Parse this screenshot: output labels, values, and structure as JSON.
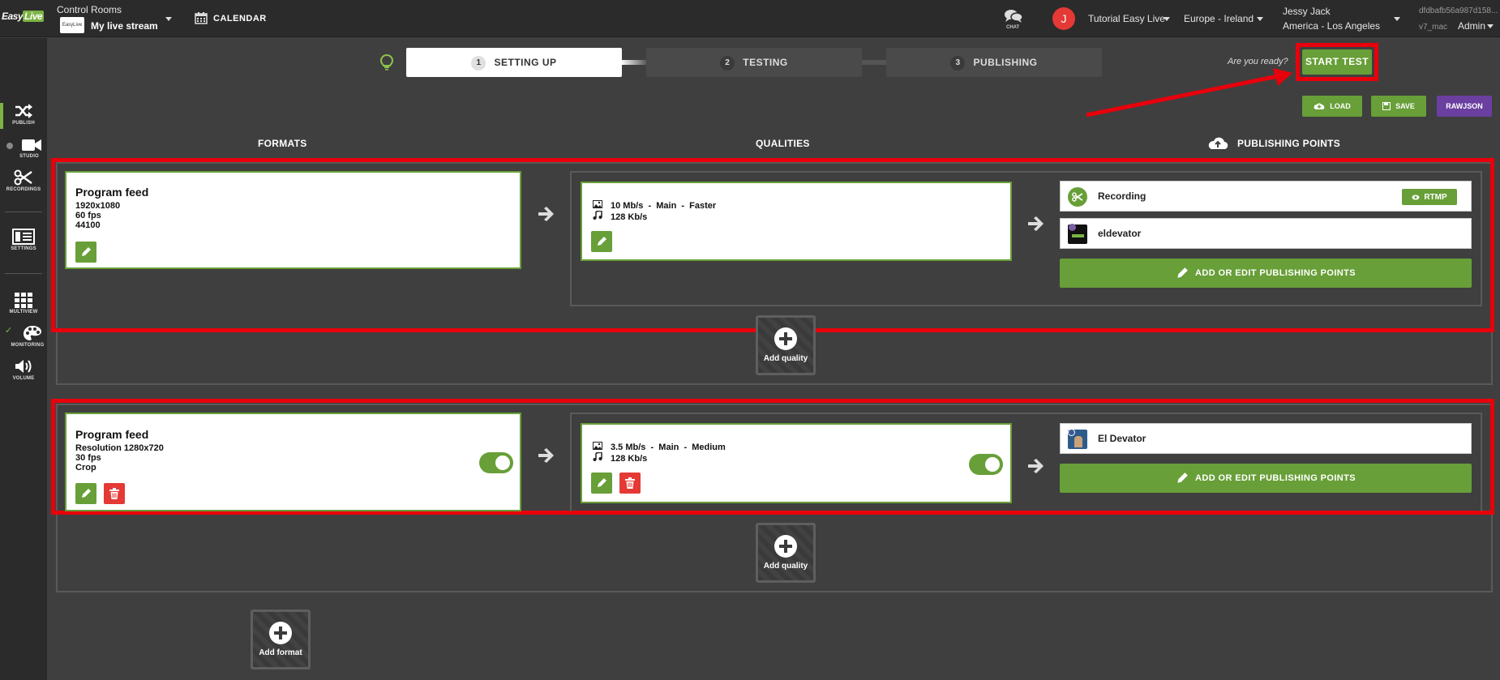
{
  "topbar": {
    "logo_text": "Easy",
    "logo_live": "Live",
    "control_rooms_label": "Control Rooms",
    "stream_thumb_text": "EasyLive",
    "stream_name": "My live stream",
    "calendar_label": "CALENDAR",
    "chat_label": "CHAT",
    "avatar_initial": "J",
    "workspace": "Tutorial Easy Live",
    "region": "Europe - Ireland",
    "user_name": "Jessy Jack",
    "user_timezone": "America - Los Angeles",
    "session_id": "dfdbafb56a987d158...",
    "version": "v7_mac",
    "role": "Admin"
  },
  "sidebar": {
    "items": [
      {
        "label": "PUBLISH",
        "icon": "shuffle-icon"
      },
      {
        "label": "STUDIO",
        "icon": "video-camera-icon"
      },
      {
        "label": "RECORDINGS",
        "icon": "scissors-icon"
      },
      {
        "label": "SETTINGS",
        "icon": "settings-panel-icon"
      },
      {
        "label": "MULTIVIEW",
        "icon": "grid-icon"
      },
      {
        "label": "MONITORING",
        "icon": "palette-icon"
      },
      {
        "label": "VOLUME",
        "icon": "speaker-icon"
      }
    ]
  },
  "steps": [
    {
      "num": "1",
      "label": "SETTING UP"
    },
    {
      "num": "2",
      "label": "TESTING"
    },
    {
      "num": "3",
      "label": "PUBLISHING"
    }
  ],
  "ready_text": "Are you ready?",
  "start_test_label": "START TEST",
  "toolbar": {
    "load_label": "LOAD",
    "save_label": "SAVE",
    "rawjson_label": "RAWJSON"
  },
  "columns": {
    "formats": "FORMATS",
    "qualities": "QUALITIES",
    "publishing_points": "PUBLISHING POINTS"
  },
  "formats": [
    {
      "title": "Program feed",
      "lines": [
        "1920x1080",
        "60 fps",
        "44100"
      ],
      "quality": {
        "video": "10 Mb/s  -  Main  -  Faster",
        "audio": "128 Kb/s"
      },
      "publishing_points": [
        {
          "name": "Recording",
          "badge": "RTMP"
        },
        {
          "name": "eldevator"
        }
      ],
      "add_pp_label": "ADD OR EDIT PUBLISHING POINTS",
      "add_quality_label": "Add quality"
    },
    {
      "title": "Program feed",
      "lines": [
        "Resolution 1280x720",
        "30 fps",
        "Crop"
      ],
      "quality": {
        "video": "3.5 Mb/s  -  Main  -  Medium",
        "audio": "128 Kb/s"
      },
      "publishing_points": [
        {
          "name": "El Devator"
        }
      ],
      "add_pp_label": "ADD OR EDIT PUBLISHING POINTS",
      "add_quality_label": "Add quality"
    }
  ],
  "add_format_label": "Add format",
  "colors": {
    "accent_green": "#689f38",
    "highlight_red": "#e8000b",
    "purple": "#6a3fa0",
    "background": "#3f3f3f"
  }
}
